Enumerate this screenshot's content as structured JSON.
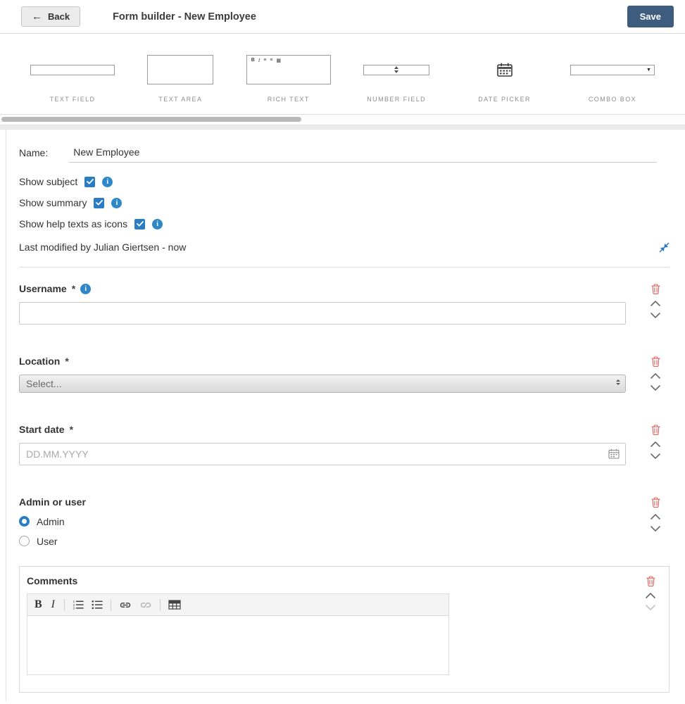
{
  "header": {
    "back": "Back",
    "title": "Form builder - New Employee",
    "save": "Save"
  },
  "palette": [
    {
      "label": "TEXT FIELD"
    },
    {
      "label": "TEXT AREA"
    },
    {
      "label": "RICH TEXT"
    },
    {
      "label": "NUMBER FIELD"
    },
    {
      "label": "DATE PICKER"
    },
    {
      "label": "COMBO BOX"
    }
  ],
  "settings": {
    "name_label": "Name:",
    "name_value": "New Employee",
    "show_subject_label": "Show subject",
    "show_summary_label": "Show summary",
    "show_help_label": "Show help texts as icons",
    "show_subject_checked": true,
    "show_summary_checked": true,
    "show_help_checked": true,
    "last_modified": "Last modified by Julian Giertsen - now"
  },
  "fields": {
    "username": {
      "label": "Username",
      "required_mark": "*",
      "value": ""
    },
    "location": {
      "label": "Location",
      "required_mark": "*",
      "value": "Select..."
    },
    "start_date": {
      "label": "Start date",
      "required_mark": "*",
      "placeholder": "DD.MM.YYYY",
      "value": ""
    },
    "admin_or_user": {
      "label": "Admin or user",
      "option_admin": "Admin",
      "option_user": "User",
      "selected": "Admin"
    },
    "comments": {
      "label": "Comments",
      "bold_label": "B",
      "italic_label": "I",
      "toolbar": [
        "bold",
        "italic",
        "ordered-list",
        "bullet-list",
        "link",
        "unlink",
        "table"
      ]
    }
  },
  "colors": {
    "accent_blue": "#2a7dc5",
    "save_button_blue": "#3e5c7e",
    "danger_red": "#dd6460"
  }
}
